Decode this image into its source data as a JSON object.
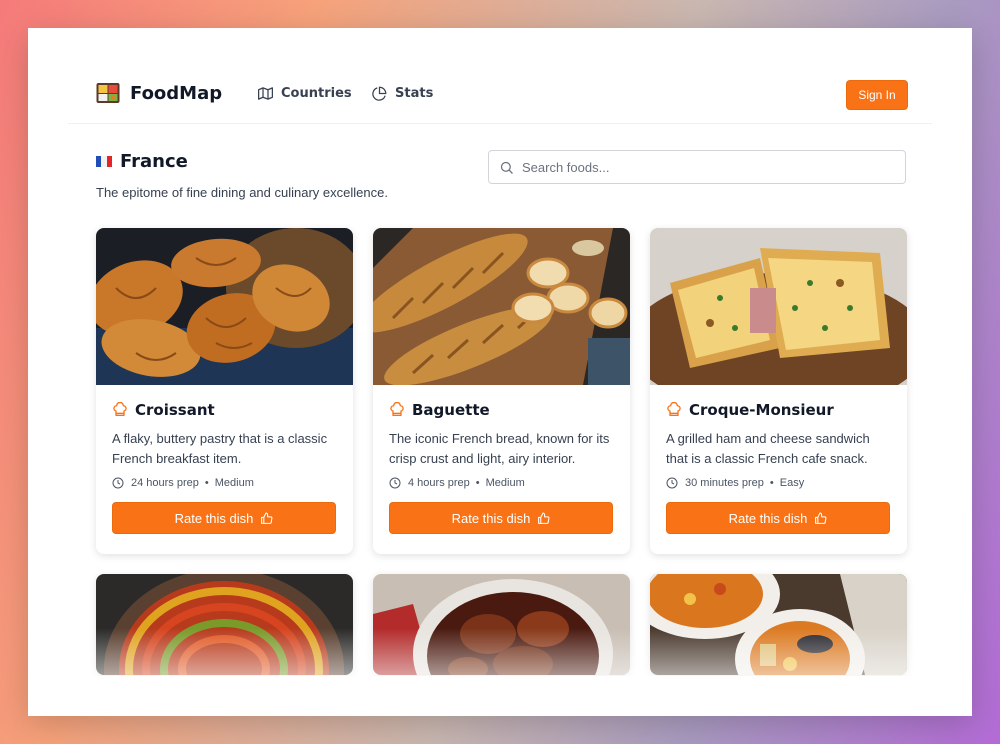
{
  "app": {
    "name": "FoodMap",
    "logo_icon": "bento-box-icon"
  },
  "nav": {
    "links": [
      {
        "label": "Countries",
        "icon": "map-icon"
      },
      {
        "label": "Stats",
        "icon": "pie-chart-icon"
      }
    ],
    "sign_in_label": "Sign In"
  },
  "country": {
    "flag": "france-flag",
    "name": "France",
    "description": "The epitome of fine dining and culinary excellence."
  },
  "search": {
    "placeholder": "Search foods...",
    "value": ""
  },
  "foods": [
    {
      "name": "Croissant",
      "description": "A flaky, buttery pastry that is a classic French breakfast item.",
      "prep": "24 hours prep",
      "difficulty": "Medium",
      "button": "Rate this dish"
    },
    {
      "name": "Baguette",
      "description": "The iconic French bread, known for its crisp crust and light, airy interior.",
      "prep": "4 hours prep",
      "difficulty": "Medium",
      "button": "Rate this dish"
    },
    {
      "name": "Croque-Monsieur",
      "description": "A grilled ham and cheese sandwich that is a classic French cafe snack.",
      "prep": "30 minutes prep",
      "difficulty": "Easy",
      "button": "Rate this dish"
    }
  ],
  "colors": {
    "accent": "#f97316",
    "accent_border": "#ea6a0c",
    "text_dark": "#111827"
  }
}
